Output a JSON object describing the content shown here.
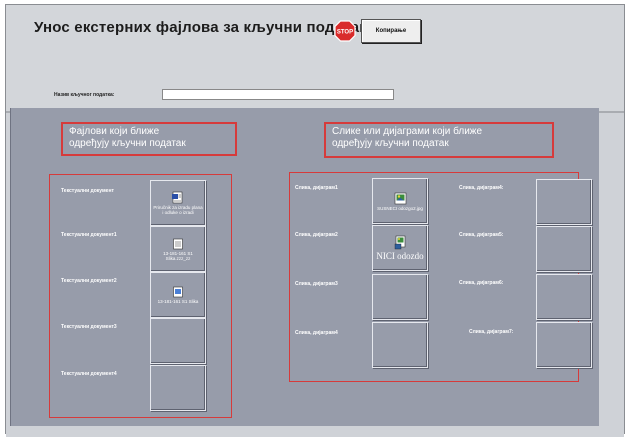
{
  "header": {
    "title": "Унос екстерних фајлова за кључни податак",
    "stop_icon": "stop-sign-icon",
    "command_button_label": "Копирање"
  },
  "key_field": {
    "label": "Назив кључног податка:",
    "value": ""
  },
  "files_section": {
    "heading_line1": "Фајлови који ближе",
    "heading_line2": "одређују кључни податак",
    "rows": [
      {
        "label": "Текстуални документ",
        "icon": "word-document-icon",
        "caption": "Priručnik za izradu plana i odluke o izradi"
      },
      {
        "label": "Текстуални документ1",
        "icon": "document-icon",
        "caption": "13-181-161 S1 Slika.zzz_zz"
      },
      {
        "label": "Текстуални документ2",
        "icon": "document-icon",
        "caption": "13-181-161 S1 Slika"
      },
      {
        "label": "Текстуални документ3",
        "icon": "",
        "caption": ""
      },
      {
        "label": "Текстуални документ4",
        "icon": "",
        "caption": ""
      }
    ]
  },
  "images_section": {
    "heading_line1": "Слике или дијаграми који ближе",
    "heading_line2": "одређују кључни податак",
    "left_column": [
      {
        "label": "Слика, дијаграм1",
        "icon": "image-file-icon",
        "caption": "SUSNECI odozgo2.jpg"
      },
      {
        "label": "Слика, дијаграм2",
        "icon": "image-file-icon",
        "caption": "NICI odozdo"
      },
      {
        "label": "Слика, дијаграм3",
        "icon": "",
        "caption": ""
      },
      {
        "label": "Слика, дијаграм4",
        "icon": "",
        "caption": ""
      }
    ],
    "right_column": [
      {
        "label": "Слика, дијаграм4:"
      },
      {
        "label": "Слика, дијаграм5:"
      },
      {
        "label": "Слика, дијаграм6:"
      },
      {
        "label": "Слика, дијаграм7:"
      }
    ]
  },
  "colors": {
    "accent_red": "#d63b3b",
    "canvas": "#979caa",
    "header": "#d3d6da"
  }
}
